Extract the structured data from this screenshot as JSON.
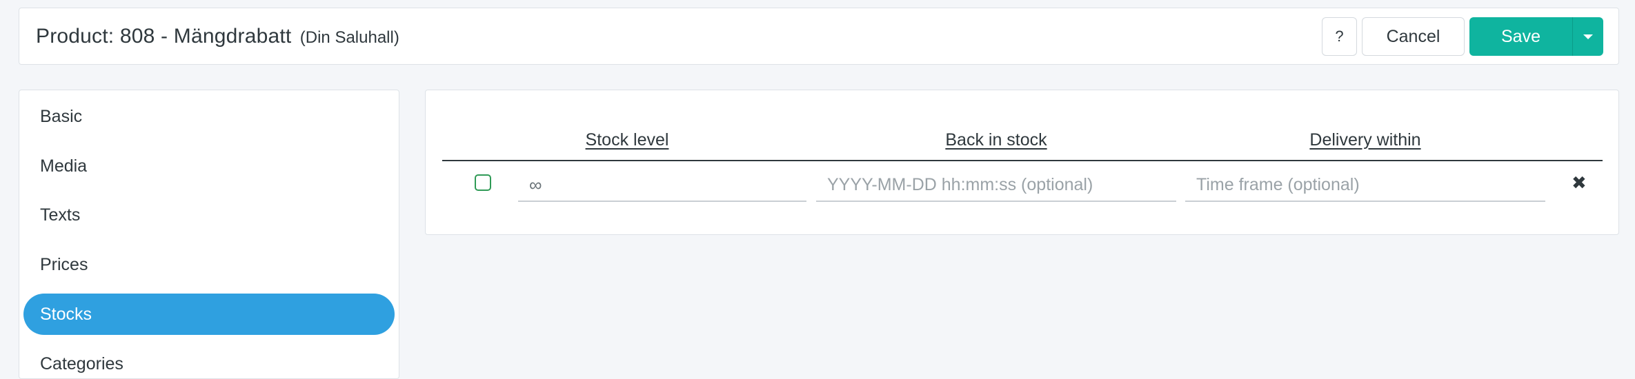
{
  "header": {
    "title": "Product: 808 - Mängdrabatt",
    "subtitle": "(Din Saluhall)",
    "help_label": "?",
    "cancel_label": "Cancel",
    "save_label": "Save"
  },
  "sidebar": {
    "items": [
      {
        "label": "Basic",
        "active": false
      },
      {
        "label": "Media",
        "active": false
      },
      {
        "label": "Texts",
        "active": false
      },
      {
        "label": "Prices",
        "active": false
      },
      {
        "label": "Stocks",
        "active": true
      },
      {
        "label": "Categories",
        "active": false
      }
    ]
  },
  "stocks": {
    "columns": {
      "stock_level": "Stock level",
      "back_in_stock": "Back in stock",
      "delivery_within": "Delivery within"
    },
    "row": {
      "checked": false,
      "stock_value": "∞",
      "back_in_stock_placeholder": "YYYY-MM-DD hh:mm:ss (optional)",
      "delivery_placeholder": "Time frame (optional)",
      "remove_icon": "✖"
    }
  },
  "colors": {
    "primary": "#0fb49f",
    "active_nav": "#2fa0e0",
    "background": "#f4f6f9",
    "checkbox_border": "#2f9a56"
  }
}
